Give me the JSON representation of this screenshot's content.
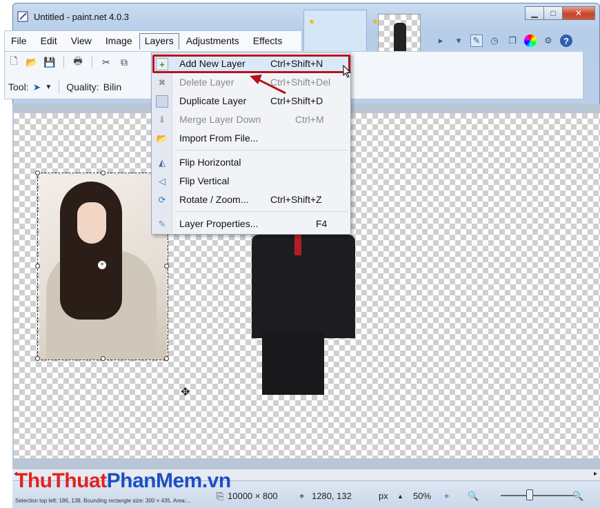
{
  "window": {
    "title": "Untitled - paint.net 4.0.3"
  },
  "menubar": {
    "items": [
      {
        "label": "File"
      },
      {
        "label": "Edit"
      },
      {
        "label": "View"
      },
      {
        "label": "Image"
      },
      {
        "label": "Layers"
      },
      {
        "label": "Adjustments"
      },
      {
        "label": "Effects"
      }
    ],
    "active": "Layers"
  },
  "toolbar": {
    "tool_label": "Tool:",
    "quality_label": "Quality:",
    "quality_value": "Bilin"
  },
  "layers_menu": {
    "items": [
      {
        "label": "Add New Layer",
        "shortcut": "Ctrl+Shift+N",
        "enabled": true,
        "icon": "add-layer-icon"
      },
      {
        "label": "Delete Layer",
        "shortcut": "Ctrl+Shift+Del",
        "enabled": false,
        "icon": "delete-layer-icon"
      },
      {
        "label": "Duplicate Layer",
        "shortcut": "Ctrl+Shift+D",
        "enabled": true,
        "icon": "duplicate-layer-icon"
      },
      {
        "label": "Merge Layer Down",
        "shortcut": "Ctrl+M",
        "enabled": false,
        "icon": "merge-layer-icon"
      },
      {
        "label": "Import From File...",
        "shortcut": "",
        "enabled": true,
        "icon": "import-file-icon"
      },
      {
        "label": "Flip Horizontal",
        "shortcut": "",
        "enabled": true,
        "icon": "flip-horizontal-icon"
      },
      {
        "label": "Flip Vertical",
        "shortcut": "",
        "enabled": true,
        "icon": "flip-vertical-icon"
      },
      {
        "label": "Rotate / Zoom...",
        "shortcut": "Ctrl+Shift+Z",
        "enabled": true,
        "icon": "rotate-zoom-icon"
      },
      {
        "label": "Layer Properties...",
        "shortcut": "F4",
        "enabled": true,
        "icon": "layer-properties-icon"
      }
    ]
  },
  "statusbar": {
    "selection_info": "Selection top left: 186, 138. Bounding rectangle size: 300 × 435. Area:...",
    "image_size": "10000 × 800",
    "cursor_pos": "1280, 132",
    "units": "px",
    "zoom": "50%"
  },
  "watermark": {
    "part1": "ThuThuat",
    "part2": "PhanMem",
    "part3": ".vn"
  },
  "colors": {
    "highlight": "#b5121b",
    "accent": "#1b4fc3"
  }
}
